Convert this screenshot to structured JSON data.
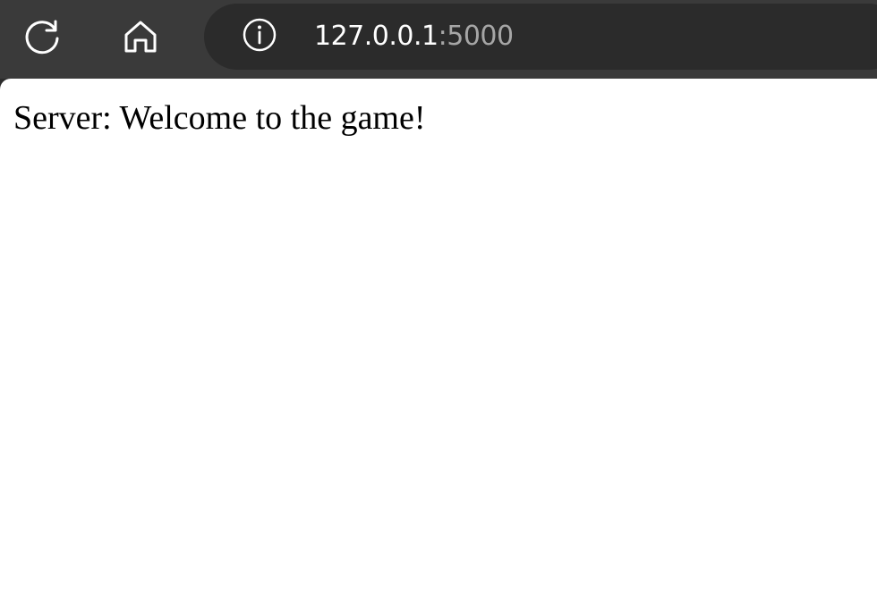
{
  "browser": {
    "toolbar": {
      "refresh_icon": "refresh-icon",
      "home_icon": "home-icon",
      "colors": {
        "toolbar_bg": "#3a3a3a",
        "address_bg": "#2b2b2b",
        "icon": "#ffffff"
      }
    },
    "address_bar": {
      "info_icon": "info-icon",
      "host": "127.0.0.1",
      "port": ":5000",
      "host_color": "#ffffff",
      "port_color": "#a6a6a6"
    }
  },
  "page": {
    "message": "Server: Welcome to the game!",
    "background": "#ffffff",
    "text_color": "#000000"
  }
}
